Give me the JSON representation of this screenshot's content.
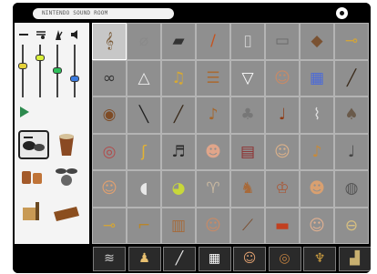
{
  "search": {
    "value": "NINTENDO SOUND ROOM"
  },
  "icons": {
    "settings": "settings-icon"
  },
  "left_panel": {
    "tools": [
      "minus-icon",
      "note-icon",
      "metronome-icon",
      "speaker-icon"
    ],
    "sliders": [
      {
        "name": "slider-1",
        "level": 0.62,
        "color": "#e6d23a"
      },
      {
        "name": "slider-2",
        "level": 0.78,
        "color": "#d9f03a"
      },
      {
        "name": "slider-3",
        "level": 0.52,
        "color": "#2fbf5a"
      },
      {
        "name": "slider-4",
        "level": 0.36,
        "color": "#3b7be0"
      }
    ],
    "modes": [
      "drum-kit-icon",
      "conga-icon",
      "drums-icon",
      "drum-set-icon",
      "tools-icon",
      "woodblock-icon"
    ]
  },
  "grid": {
    "selected_index": 0,
    "items": [
      "violin-case-icon",
      "tuba-icon",
      "grand-piano-icon",
      "oboe-icon",
      "tube-icon",
      "harmonica-icon",
      "guitar-body-icon",
      "trumpet-icon",
      "bicycle-icon",
      "triangle-icon",
      "horn-icon",
      "xylophone-icon",
      "cup-icon",
      "face-icon",
      "keyboard-icon",
      "flute-icon",
      "tambourine-icon",
      "clarinet-icon",
      "flute-icon",
      "mandolin-icon",
      "bagpipe-icon",
      "violin-icon",
      "harp-icon",
      "bell-icon",
      "banjo-icon",
      "saxophone-icon",
      "guitar-icon",
      "baby-face-icon",
      "accordion-icon",
      "singer-icon",
      "acoustic-guitar-icon",
      "electric-guitar-icon",
      "girl-face-icon",
      "duck-icon",
      "alien-icon",
      "goat-icon",
      "horse-icon",
      "rooster-icon",
      "boy-face-icon",
      "monkey-icon",
      "trumpet-icon",
      "gun-icon",
      "pipe-organ-icon",
      "face-icon",
      "trombone-icon",
      "chips-icon",
      "baby-icon",
      "cymbals-icon"
    ]
  },
  "categories": [
    "wave-icon",
    "guitarist-icon",
    "baton-icon",
    "keyboard-icon",
    "family-icon",
    "drums-icon",
    "lyre-icon",
    "easel-icon"
  ]
}
